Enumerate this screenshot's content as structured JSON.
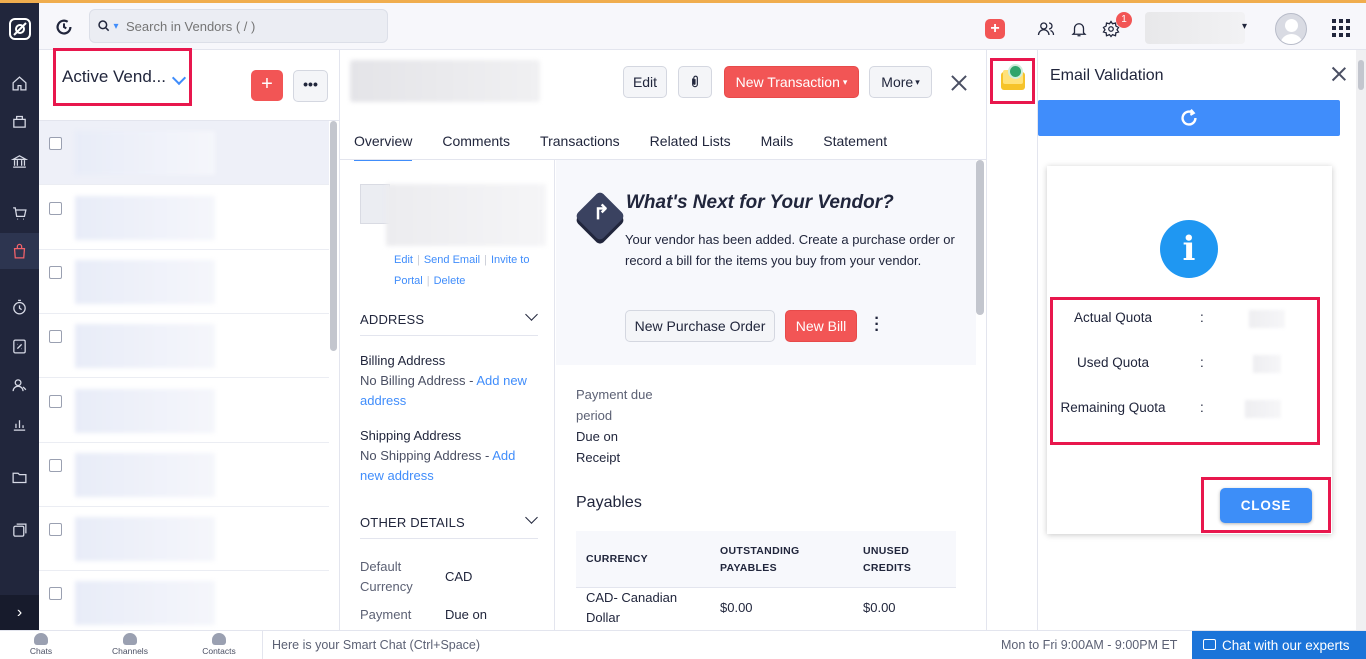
{
  "app": {
    "search_placeholder": "Search in Vendors ( / )",
    "notification_count": "1"
  },
  "sidebar": {
    "icons": [
      "home-icon",
      "items-icon",
      "banking-icon",
      "sales-icon",
      "purchases-icon",
      "time-tracking-icon",
      "accountant-icon",
      "vendors-icon",
      "reports-icon",
      "documents-icon",
      "integrations-icon"
    ],
    "expand_glyph": "›"
  },
  "list": {
    "view_label": "Active Vend...",
    "add_glyph": "+",
    "more_glyph": "•••"
  },
  "detail": {
    "buttons": {
      "edit": "Edit",
      "new_transaction": "New Transaction",
      "more": "More"
    },
    "tabs": [
      "Overview",
      "Comments",
      "Transactions",
      "Related Lists",
      "Mails",
      "Statement"
    ],
    "contact_links": {
      "edit": "Edit",
      "send_email": "Send Email",
      "invite_to_portal": "Invite to Portal",
      "delete": "Delete"
    },
    "address": {
      "section_title": "ADDRESS",
      "billing_title": "Billing Address",
      "billing_text": "No Billing Address -",
      "billing_link": "Add new address",
      "shipping_title": "Shipping Address",
      "shipping_text": "No Shipping Address -",
      "shipping_link": "Add new address"
    },
    "other_details": {
      "section_title": "OTHER DETAILS",
      "currency_label": "Default Currency",
      "currency_value": "CAD",
      "payment_label": "Payment",
      "payment_value": "Due on"
    },
    "whats_next": {
      "title": "What's Next for Your Vendor?",
      "text": "Your vendor has been added. Create a purchase order or record a bill for the items you buy from your vendor.",
      "new_po": "New Purchase Order",
      "new_bill": "New Bill"
    },
    "payment_due_label": "Payment due period",
    "payment_due_value": "Due on Receipt",
    "payables": {
      "title": "Payables",
      "headers": [
        "CURRENCY",
        "OUTSTANDING PAYABLES",
        "UNUSED CREDITS"
      ],
      "rows": [
        [
          "CAD- Canadian Dollar",
          "$0.00",
          "$0.00"
        ]
      ]
    }
  },
  "email_validation": {
    "title": "Email Validation",
    "info_glyph": "i",
    "quota": [
      {
        "label": "Actual Quota",
        "colon": ":"
      },
      {
        "label": "Used Quota",
        "colon": ":"
      },
      {
        "label": "Remaining Quota",
        "colon": ":"
      }
    ],
    "close_label": "CLOSE"
  },
  "bottom_bar": {
    "items": [
      "Chats",
      "Channels",
      "Contacts"
    ],
    "smart_chat": "Here is your Smart Chat (Ctrl+Space)",
    "hours": "Mon to Fri 9:00AM - 9:00PM ET",
    "chat_experts": "Chat with our experts"
  }
}
